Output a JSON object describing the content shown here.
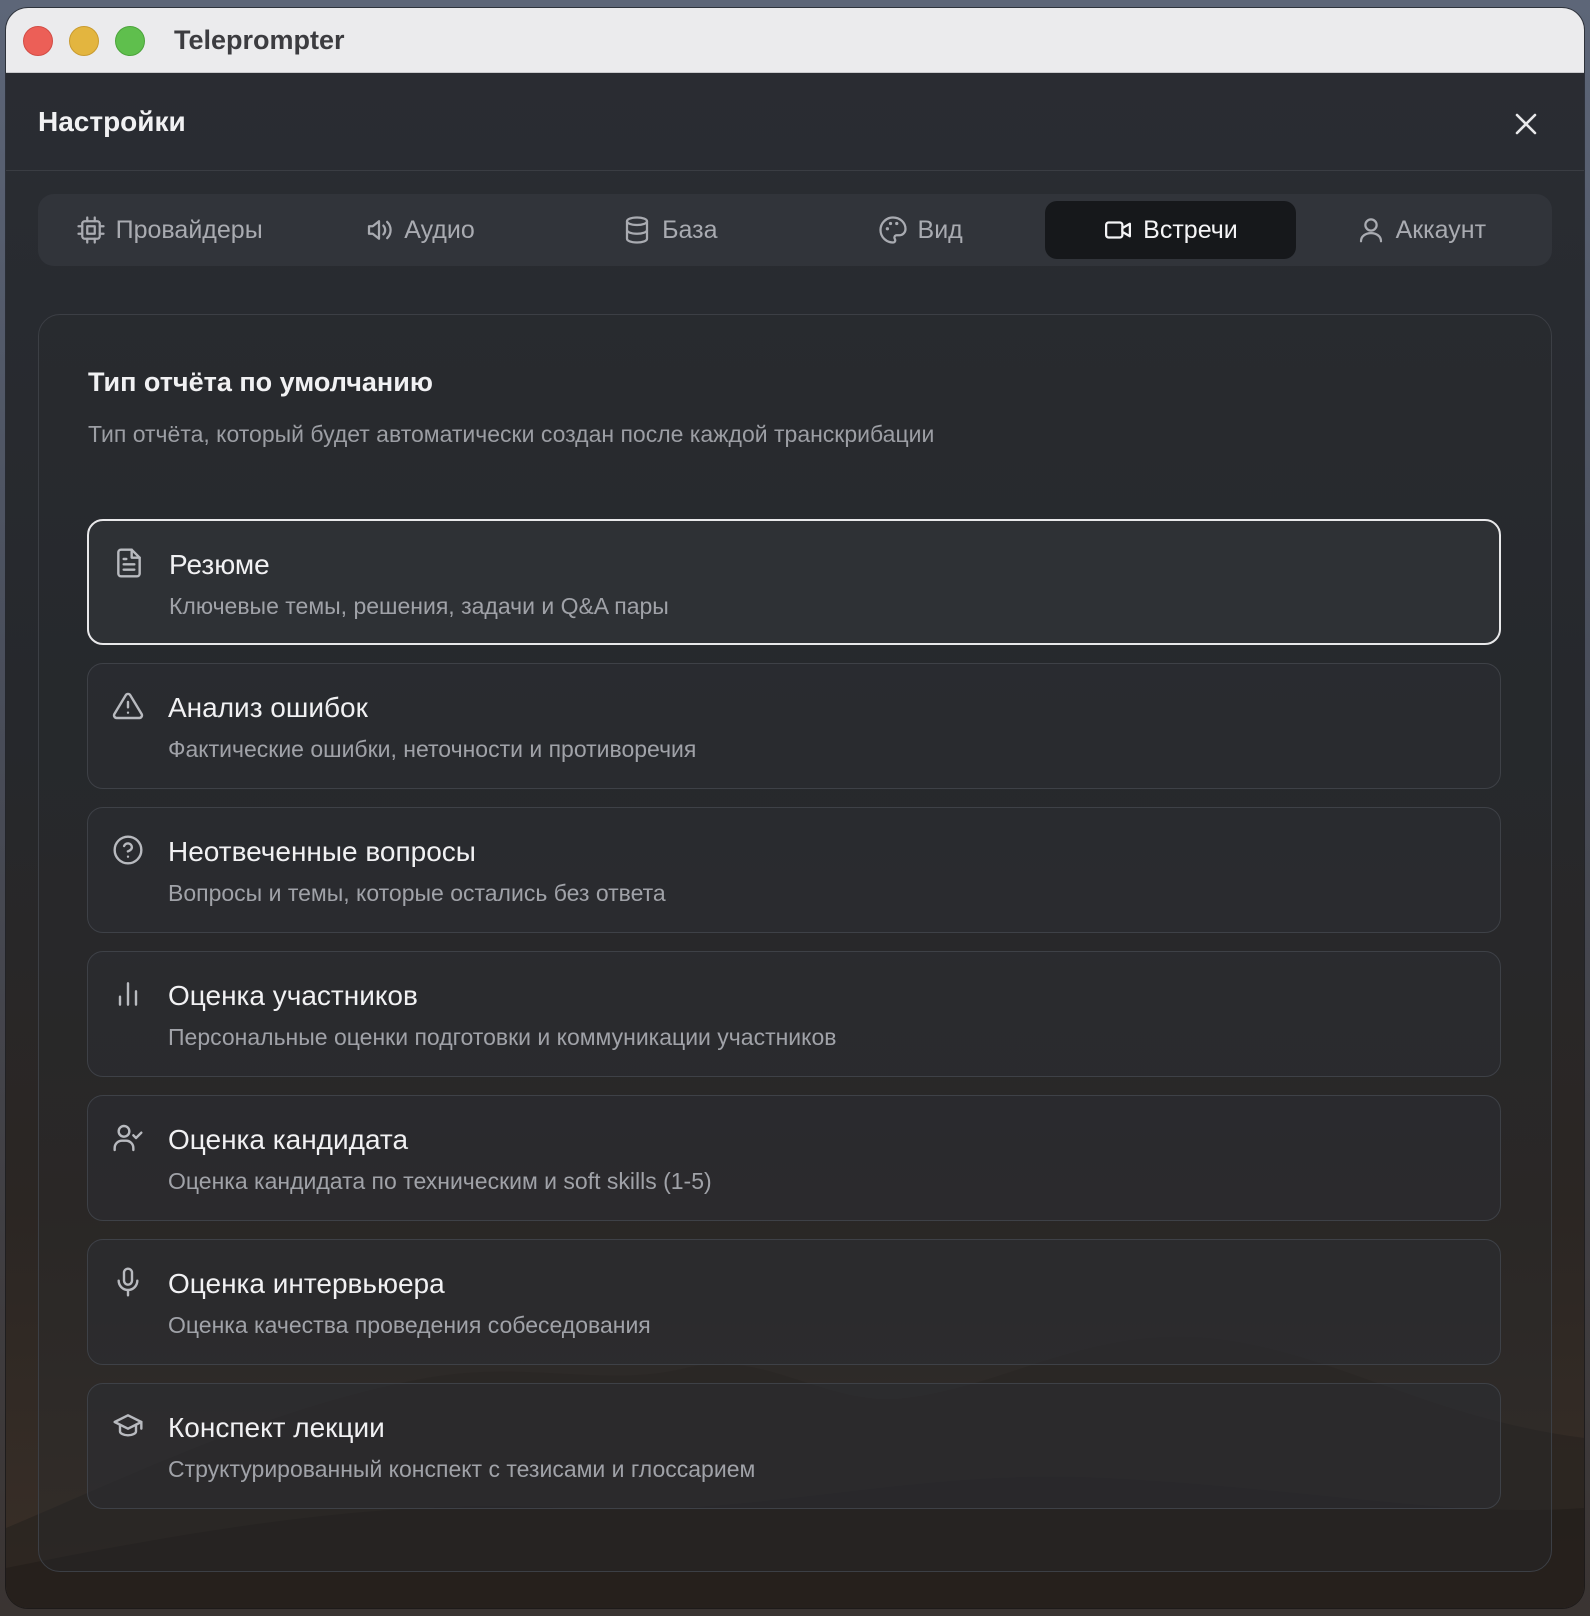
{
  "window": {
    "title": "Teleprompter"
  },
  "header": {
    "title": "Настройки"
  },
  "tabs": [
    {
      "label": "Провайдеры",
      "icon": "cpu-icon",
      "active": false
    },
    {
      "label": "Аудио",
      "icon": "speaker-icon",
      "active": false
    },
    {
      "label": "База",
      "icon": "database-icon",
      "active": false
    },
    {
      "label": "Вид",
      "icon": "palette-icon",
      "active": false
    },
    {
      "label": "Встречи",
      "icon": "video-icon",
      "active": true
    },
    {
      "label": "Аккаунт",
      "icon": "user-icon",
      "active": false
    }
  ],
  "section": {
    "title": "Тип отчёта по умолчанию",
    "description": "Тип отчёта, который будет автоматически создан после каждой транскрибации"
  },
  "options": [
    {
      "title": "Резюме",
      "description": "Ключевые темы, решения, задачи и Q&A пары",
      "icon": "document-icon",
      "selected": true
    },
    {
      "title": "Анализ ошибок",
      "description": "Фактические ошибки, неточности и противоречия",
      "icon": "warning-icon",
      "selected": false
    },
    {
      "title": "Неотвеченные вопросы",
      "description": "Вопросы и темы, которые остались без ответа",
      "icon": "question-icon",
      "selected": false
    },
    {
      "title": "Оценка участников",
      "description": "Персональные оценки подготовки и коммуникации участников",
      "icon": "bar-chart-icon",
      "selected": false
    },
    {
      "title": "Оценка кандидата",
      "description": "Оценка кандидата по техническим и soft skills (1-5)",
      "icon": "user-check-icon",
      "selected": false
    },
    {
      "title": "Оценка интервьюера",
      "description": "Оценка качества проведения собеседования",
      "icon": "microphone-icon",
      "selected": false
    },
    {
      "title": "Конспект лекции",
      "description": "Структурированный конспект с тезисами и глоссарием",
      "icon": "graduation-cap-icon",
      "selected": false
    }
  ]
}
